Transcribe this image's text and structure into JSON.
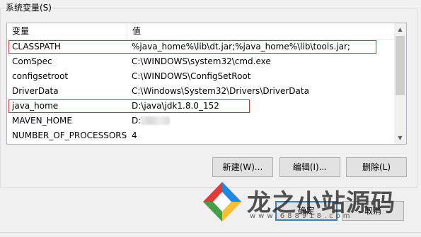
{
  "group": {
    "label": "系统变量(S)"
  },
  "table": {
    "headers": [
      "变量",
      "值"
    ],
    "rows": [
      {
        "name": "CLASSPATH",
        "value": "%java_home%\\lib\\dt.jar;%java_home%\\lib\\tools.jar;",
        "highlighted": true
      },
      {
        "name": "ComSpec",
        "value": "C:\\WINDOWS\\system32\\cmd.exe"
      },
      {
        "name": "configsetroot",
        "value": "C:\\WINDOWS\\ConfigSetRoot"
      },
      {
        "name": "DriverData",
        "value": "C:\\Windows\\System32\\Drivers\\DriverData"
      },
      {
        "name": "java_home",
        "value": "D:\\java\\jdk1.8.0_152",
        "highlighted": true
      },
      {
        "name": "MAVEN_HOME",
        "value": "D:\\"
      },
      {
        "name": "NUMBER_OF_PROCESSORS",
        "value": "4"
      }
    ]
  },
  "buttons": {
    "new": "新建(W)...",
    "edit": "编辑(I)...",
    "delete": "删除(L)",
    "ok": "确定",
    "cancel": "取消"
  },
  "watermark": {
    "text": "龙之小站源码",
    "url": "www.688918.com"
  },
  "colors": {
    "highlight_border": "#d9303b",
    "primary_button_border": "#3c7fb1"
  },
  "icons": [
    "scroll-up-arrow-icon",
    "scroll-down-arrow-icon",
    "watermark-logo-icon"
  ]
}
